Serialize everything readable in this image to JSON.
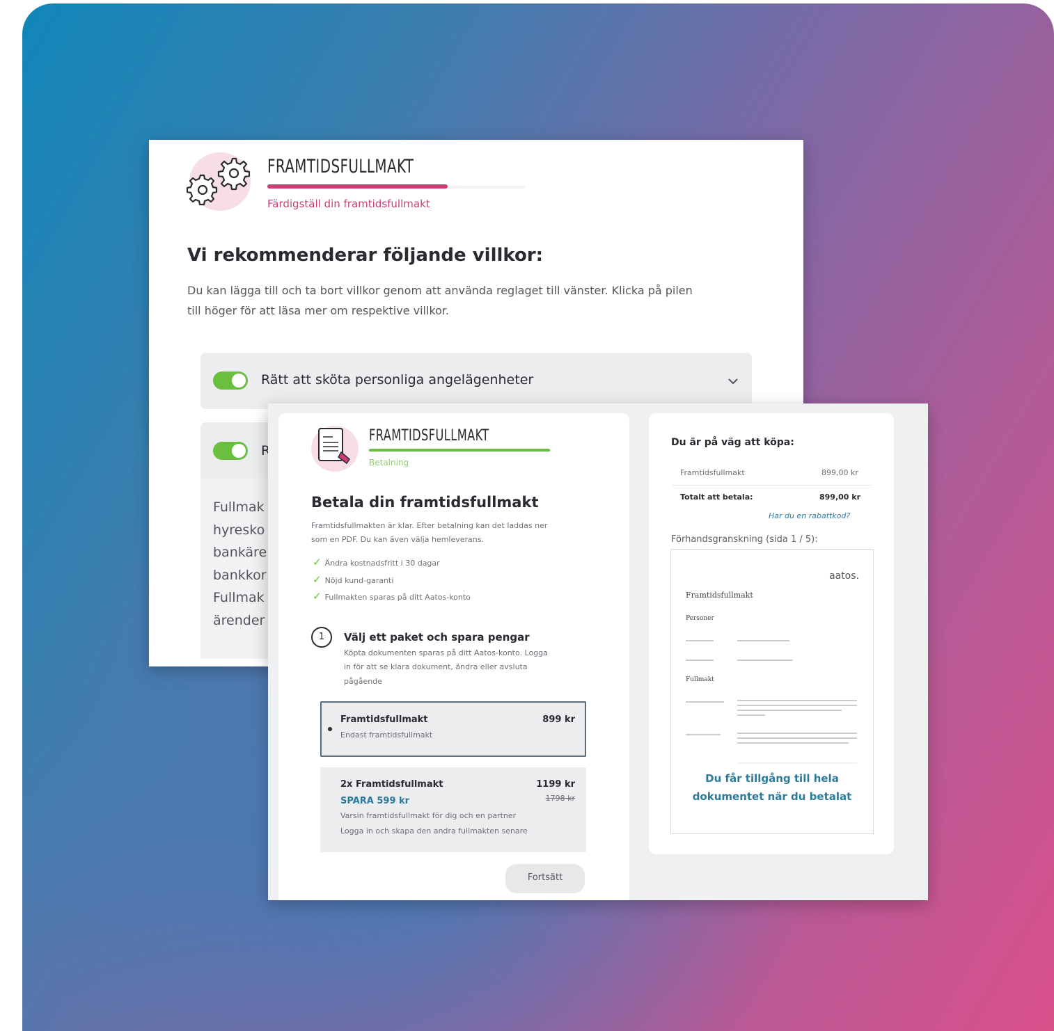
{
  "colors": {
    "accent_pink": "#c93e74",
    "accent_green": "#6abf3e",
    "accent_teal": "#2c7a9c",
    "gradient_start": "#1186b8",
    "gradient_end": "#d9508a"
  },
  "icons": {
    "header_back": "gears-icon",
    "header_front": "document-icon",
    "chevron": "chevron-down-icon",
    "check": "check-icon"
  },
  "back_card": {
    "header_title": "FRAMTIDSFULLMAKT",
    "header_subtitle": "Färdigställ din framtidsfullmakt",
    "progress": 0.7,
    "heading": "Vi rekommenderar följande villkor:",
    "intro_line1": "Du kan lägga till och ta bort villkor genom att använda reglaget till vänster. Klicka på pilen",
    "intro_line2": "till höger för att läsa mer om respektive villkor.",
    "accordion": [
      {
        "label": "Rätt att sköta personliga angelägenheter",
        "enabled": true
      },
      {
        "label": "R",
        "enabled": true
      }
    ],
    "body_fragments": [
      "Fullmak",
      "hyresko",
      "bankäre",
      "bankkor",
      "Fullmak",
      "ärender"
    ]
  },
  "payment": {
    "header_title": "FRAMTIDSFULLMAKT",
    "header_subtitle": "Betalning",
    "progress": 1.0,
    "heading": "Betala din framtidsfullmakt",
    "desc_line1": "Framtidsfullmakten är klar. Efter betalning kan det laddas ner",
    "desc_line2": "som en PDF. Du kan även välja hemleverans.",
    "benefits": [
      "Ändra kostnadsfritt i 30 dagar",
      "Nöjd kund-garanti",
      "Fullmakten sparas på ditt Aatos-konto"
    ],
    "step_number": "1",
    "step_title": "Välj ett paket och spara pengar",
    "step_desc_line1": "Köpta dokumenten sparas på ditt Aatos-konto. Logga",
    "step_desc_line2": "in för att se klara dokument, ändra eller avsluta",
    "step_desc_line3": "pågående",
    "packages": [
      {
        "name": "Framtidsfullmakt",
        "price": "899 kr",
        "desc": "Endast framtidsfullmakt",
        "selected": true
      },
      {
        "name": "2x Framtidsfullmakt",
        "price": "1199 kr",
        "old_price": "1798 kr",
        "save": "SPARA 599 kr",
        "desc_line1": "Varsin framtidsfullmakt för dig och en partner",
        "desc_line2": "Logga in och skapa den andra fullmakten senare",
        "selected": false
      }
    ],
    "continue_label": "Fortsätt"
  },
  "summary": {
    "title": "Du är på väg att köpa:",
    "item_label": "Framtidsfullmakt",
    "item_price": "899,00 kr",
    "total_label": "Totalt att betala:",
    "total_price": "899,00 kr",
    "discount_link": "Har du en rabattkod?",
    "preview_label": "Förhandsgranskning (sida 1 / 5):",
    "preview_brand": "aatos.",
    "preview_doc_title": "Framtidsfullmakt",
    "preview_section1": "Personer",
    "preview_section2": "Fullmakt",
    "preview_overlay_line1": "Du får tillgång till hela",
    "preview_overlay_line2": "dokumentet när du betalat"
  }
}
